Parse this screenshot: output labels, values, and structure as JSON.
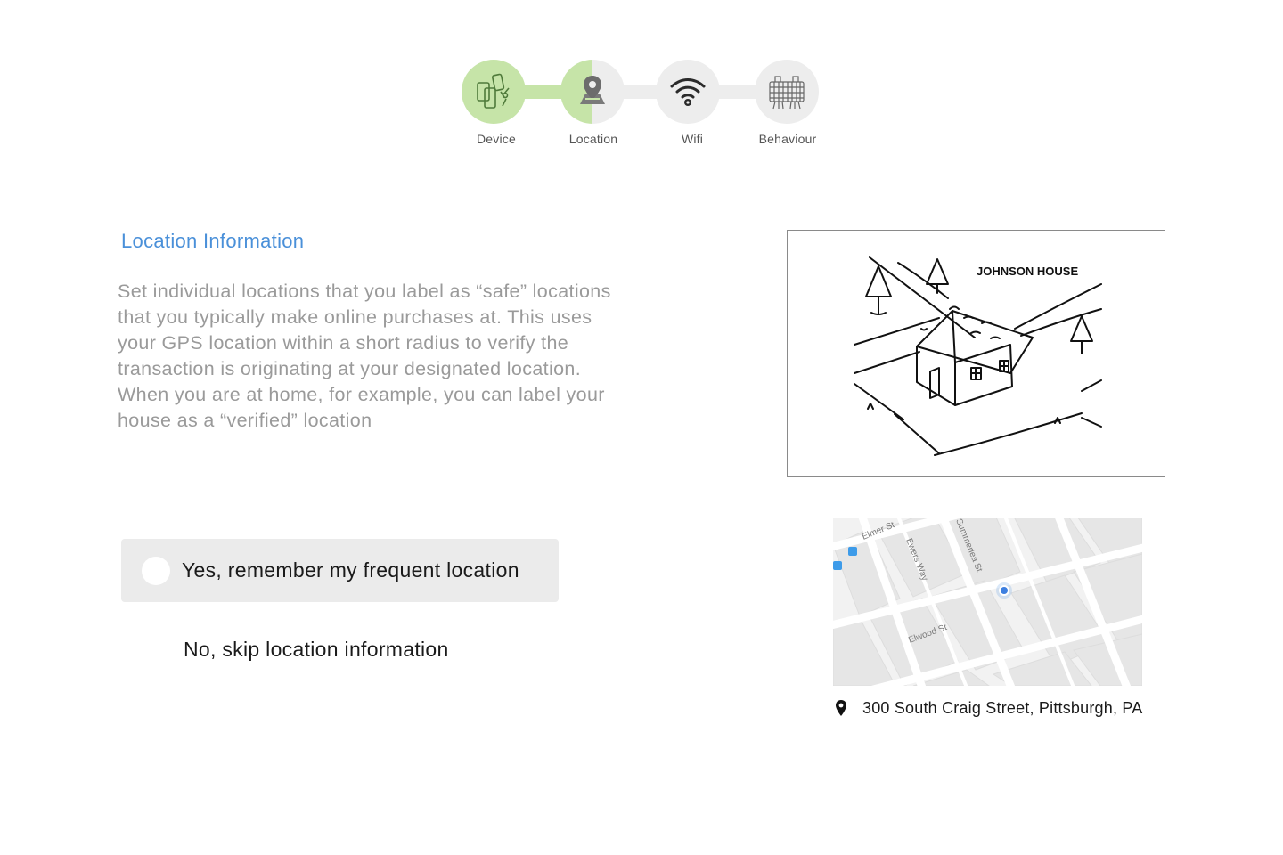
{
  "stepper": {
    "steps": [
      {
        "label": "Device",
        "icon": "devices-icon",
        "state": "complete"
      },
      {
        "label": "Location",
        "icon": "map-pin-icon",
        "state": "in-progress"
      },
      {
        "label": "Wifi",
        "icon": "wifi-icon",
        "state": "pending"
      },
      {
        "label": "Behaviour",
        "icon": "keyboard-hands-icon",
        "state": "pending"
      }
    ],
    "colors": {
      "complete": "#c6e4a8",
      "pending": "#ededed"
    }
  },
  "section": {
    "title": "Location Information",
    "description": "Set individual locations that you label as “safe” locations that you typically make online purchases at. This uses your GPS location within a short radius to verify the transaction is originating at your designated location. When you are at home, for example, you can label your house as a “verified” location"
  },
  "options": {
    "yes_label": "Yes, remember my frequent location",
    "no_label": "No, skip location information"
  },
  "sketch": {
    "caption": "JOHNSON HOUSE"
  },
  "map": {
    "streets": [
      "Elmer St",
      "Ewers Way",
      "Summerlea St",
      "Elwood St"
    ],
    "address": "300 South Craig Street, Pittsburgh, PA"
  },
  "colors": {
    "accent": "#4a90d9",
    "description_text": "#9a9a9a",
    "option_bg": "#ebebeb"
  }
}
